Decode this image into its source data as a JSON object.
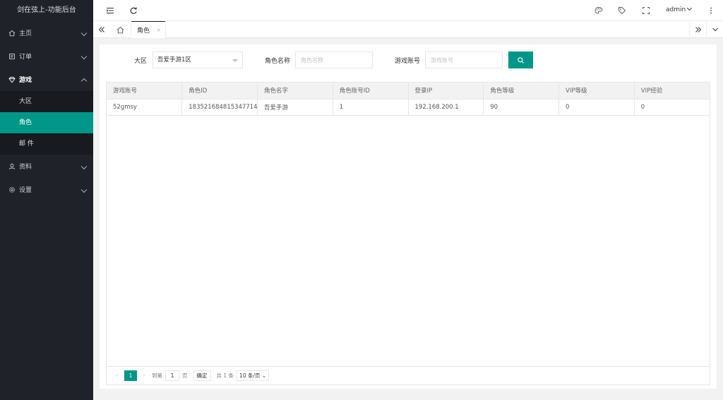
{
  "app_title": "剑在弦上-功能后台",
  "sidebar": {
    "items": [
      {
        "label": "主页",
        "icon": "home-icon"
      },
      {
        "label": "订单",
        "icon": "order-icon"
      },
      {
        "label": "游戏",
        "icon": "diamond-icon"
      },
      {
        "label": "资料",
        "icon": "user-icon"
      },
      {
        "label": "设置",
        "icon": "gear-icon"
      }
    ],
    "game_sub": [
      "大区",
      "角色",
      "邮 件"
    ]
  },
  "header": {
    "user": "admin"
  },
  "tabs": [
    {
      "label": "角色",
      "close": "×"
    }
  ],
  "search": {
    "zone_label": "大区",
    "zone_value": "吾爱手游1区",
    "role_name_label": "角色名称",
    "role_name_placeholder": "角色名称",
    "account_label": "游戏账号",
    "account_placeholder": "游戏账号"
  },
  "table": {
    "headers": [
      "游戏账号",
      "角色ID",
      "角色名字",
      "角色账号ID",
      "登录IP",
      "角色等级",
      "VIP等级",
      "VIP经验"
    ],
    "rows": [
      [
        "52gmsy",
        "183521684815347714",
        "吾爱手游",
        "1",
        "192.168.200.1",
        "90",
        "0",
        "0"
      ]
    ]
  },
  "pager": {
    "current": "1",
    "goto_prefix": "到第",
    "goto_value": "1",
    "goto_suffix": "页",
    "ok": "确定",
    "total": "共 1 条",
    "page_size": "10 条/页"
  },
  "colors": {
    "accent": "#009688",
    "sidebar": "#20222a"
  }
}
